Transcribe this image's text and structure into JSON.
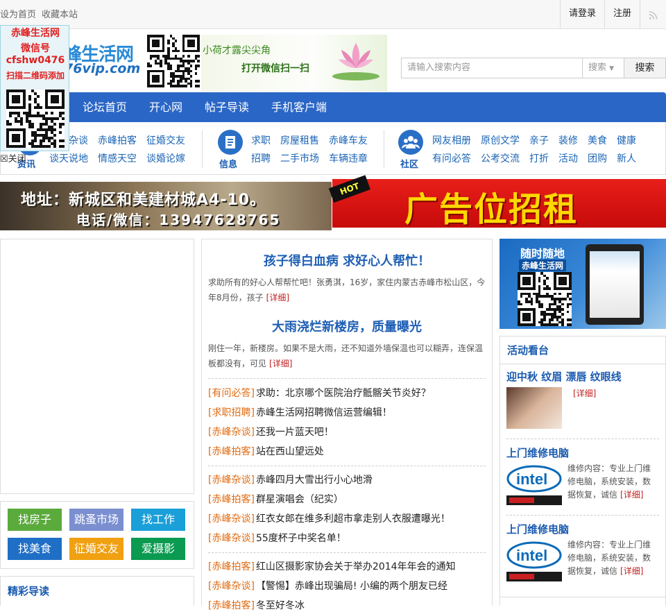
{
  "topbar": {
    "set_home": "设为首页",
    "bookmark": "收藏本站",
    "login": "请登录",
    "register": "注册"
  },
  "logo": {
    "name_part": "峰生活网",
    "domain_part": "76vip.com"
  },
  "header_promo": {
    "slogan1": "小荷才露尖尖角",
    "slogan2": "打开微信扫一扫"
  },
  "search": {
    "placeholder": "请输入搜索内容",
    "scope": "搜索",
    "button": "搜索"
  },
  "nav": {
    "items": [
      "论坛首页",
      "开心网",
      "帖子导读",
      "手机客户端"
    ]
  },
  "categories": {
    "news": {
      "title": "资讯",
      "links": [
        "赤峰杂谈",
        "赤峰拍客",
        "征婚交友",
        "谈天说地",
        "情感天空",
        "谈婚论嫁"
      ]
    },
    "info": {
      "title": "信息",
      "links": [
        "求职",
        "房屋租售",
        "赤峰车友",
        "招聘",
        "二手市场",
        "车辆违章"
      ]
    },
    "community": {
      "title": "社区",
      "links": [
        "网友相册",
        "原创文学",
        "亲子",
        "装修",
        "美食",
        "健康",
        "有问必答",
        "公考交流",
        "打折",
        "活动",
        "团购",
        "新人"
      ]
    }
  },
  "banners": {
    "left_line1": "地址：新城区和美建材城A4-10。",
    "left_line2": "电话/微信：13947628765",
    "right_hot": "HOT",
    "right_text": "广告位招租"
  },
  "floating_ad": {
    "line1": "赤峰生活网",
    "line2": "微信号",
    "line3": "cfshw0476",
    "line4": "扫描二维码添加",
    "close": "关闭"
  },
  "quick_tiles": [
    {
      "label": "找房子",
      "color": "#5aaa3c"
    },
    {
      "label": "跳蚤市场",
      "color": "#7b8fd0"
    },
    {
      "label": "找工作",
      "color": "#1a9fd8"
    },
    {
      "label": "找美食",
      "color": "#1f6fc6"
    },
    {
      "label": "征婚交友",
      "color": "#f0a010"
    },
    {
      "label": "爱摄影",
      "color": "#0a9a50"
    }
  ],
  "guide": {
    "title": "精彩导读"
  },
  "featured": [
    {
      "title": "孩子得白血病 求好心人帮忙！",
      "summary": "求助所有的好心人帮帮忙吧！张勇淇，16岁，家住内蒙古赤峰市松山区，今年8月份，孩子",
      "more": "[详细]"
    },
    {
      "title": "大雨浇烂新楼房，质量曝光",
      "summary": "刚住一年，新楼房。如果不是大雨，还不知道外墙保温也可以糊弄，连保温板都没有，可见",
      "more": "[详细]"
    }
  ],
  "post_groups": [
    [
      {
        "tag": "[有问必答]",
        "title": "求助：北京哪个医院治疗骶髂关节炎好？"
      },
      {
        "tag": "[求职招聘]",
        "title": "赤峰生活网招聘微信运营编辑！"
      },
      {
        "tag": "[赤峰杂谈]",
        "title": "还我一片蓝天吧！"
      },
      {
        "tag": "[赤峰拍客]",
        "title": "站在西山望远处"
      }
    ],
    [
      {
        "tag": "[赤峰杂谈]",
        "title": "赤峰四月大雪出行小心地滑"
      },
      {
        "tag": "[赤峰拍客]",
        "title": "群星演唱会（纪实）"
      },
      {
        "tag": "[赤峰杂谈]",
        "title": "红衣女郎在维多利超市拿走别人衣服遭曝光！"
      },
      {
        "tag": "[赤峰杂谈]",
        "title": "55度杯子中奖名单！"
      }
    ],
    [
      {
        "tag": "[赤峰拍客]",
        "title": "红山区摄影家协会关于举办2014年年会的通知"
      },
      {
        "tag": "[赤峰杂谈]",
        "title": "【警惕】赤峰出现骗局! 小编的两个朋友已经"
      },
      {
        "tag": "[赤峰拍客]",
        "title": "冬至好冬冰"
      }
    ]
  ],
  "app_banner": {
    "line1": "随时随地",
    "line2": "赤峰生活网"
  },
  "activity": {
    "title": "活动看台",
    "items": [
      {
        "heading": "迎中秋 纹眉 漂唇 纹眼线",
        "text": "",
        "more": "[详细]"
      },
      {
        "heading": "上门维修电脑",
        "text": "维修内容：专业上门维修电脑，系统安装，数据恢复，诚信",
        "more": "[详细]"
      },
      {
        "heading": "上门维修电脑",
        "text": "维修内容：专业上门维修电脑，系统安装，数据恢复，诚信",
        "more": "[详细]"
      }
    ]
  }
}
